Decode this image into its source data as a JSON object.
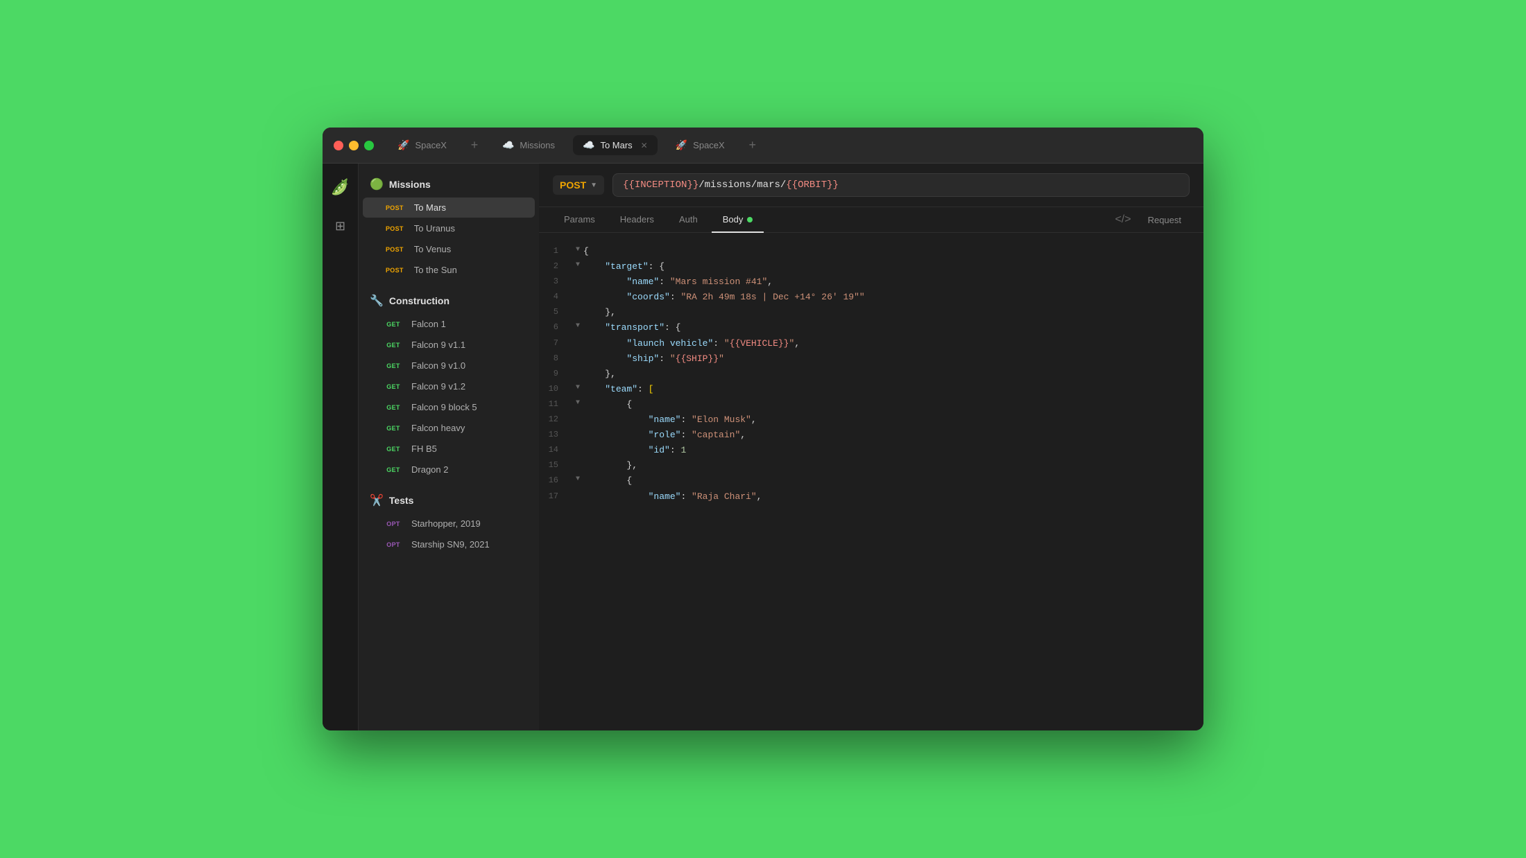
{
  "window": {
    "title": "SpaceX"
  },
  "tabs": [
    {
      "id": "tab-spacex-1",
      "label": "SpaceX",
      "icon": "🚀",
      "active": false,
      "closable": false
    },
    {
      "id": "tab-missions",
      "label": "Missions",
      "icon": "☁️",
      "active": false,
      "closable": false
    },
    {
      "id": "tab-tomars",
      "label": "To Mars",
      "icon": "☁️",
      "active": true,
      "closable": true
    },
    {
      "id": "tab-spacex-2",
      "label": "SpaceX",
      "icon": "🚀",
      "active": false,
      "closable": false
    }
  ],
  "sidebar": {
    "sections": [
      {
        "id": "missions",
        "label": "Missions",
        "icon": "🟢",
        "items": [
          {
            "id": "to-mars",
            "method": "POST",
            "name": "To Mars",
            "active": true
          },
          {
            "id": "to-uranus",
            "method": "POST",
            "name": "To Uranus",
            "active": false
          },
          {
            "id": "to-venus",
            "method": "POST",
            "name": "To Venus",
            "active": false
          },
          {
            "id": "to-the-sun",
            "method": "POST",
            "name": "To the Sun",
            "active": false
          }
        ]
      },
      {
        "id": "construction",
        "label": "Construction",
        "icon": "🔧",
        "items": [
          {
            "id": "falcon-1",
            "method": "GET",
            "name": "Falcon 1",
            "active": false
          },
          {
            "id": "falcon-9-v1-1",
            "method": "GET",
            "name": "Falcon 9 v1.1",
            "active": false
          },
          {
            "id": "falcon-9-v1-0",
            "method": "GET",
            "name": "Falcon 9 v1.0",
            "active": false
          },
          {
            "id": "falcon-9-v1-2",
            "method": "GET",
            "name": "Falcon 9 v1.2",
            "active": false
          },
          {
            "id": "falcon-9-block-5",
            "method": "GET",
            "name": "Falcon 9 block 5",
            "active": false
          },
          {
            "id": "falcon-heavy",
            "method": "GET",
            "name": "Falcon heavy",
            "active": false
          },
          {
            "id": "fh-b5",
            "method": "GET",
            "name": "FH B5",
            "active": false
          },
          {
            "id": "dragon-2",
            "method": "GET",
            "name": "Dragon 2",
            "active": false
          }
        ]
      },
      {
        "id": "tests",
        "label": "Tests",
        "icon": "✂️",
        "items": [
          {
            "id": "starhopper",
            "method": "OPT",
            "name": "Starhopper, 2019",
            "active": false
          },
          {
            "id": "starship-sn9",
            "method": "OPT",
            "name": "Starship SN9, 2021",
            "active": false
          }
        ]
      }
    ]
  },
  "url_bar": {
    "method": "POST",
    "url": "{{INCEPTION}}/missions/mars/{{ORBIT}}"
  },
  "req_tabs": {
    "params_label": "Params",
    "headers_label": "Headers",
    "auth_label": "Auth",
    "body_label": "Body",
    "request_label": "Request"
  },
  "code": [
    {
      "line": 1,
      "collapse": true,
      "indent": 0,
      "content": "{"
    },
    {
      "line": 2,
      "collapse": true,
      "indent": 1,
      "key": "target",
      "type": "obj_open"
    },
    {
      "line": 3,
      "collapse": false,
      "indent": 2,
      "key": "name",
      "value": "Mars mission #41",
      "type": "string"
    },
    {
      "line": 4,
      "collapse": false,
      "indent": 2,
      "key": "coords",
      "value": "RA 2h 49m 18s | Dec +14° 26' 19\"",
      "type": "string"
    },
    {
      "line": 5,
      "collapse": false,
      "indent": 1,
      "content": "},",
      "type": "close"
    },
    {
      "line": 6,
      "collapse": true,
      "indent": 1,
      "key": "transport",
      "type": "obj_open"
    },
    {
      "line": 7,
      "collapse": false,
      "indent": 2,
      "key": "launch vehicle",
      "value": "{{VEHICLE}}",
      "type": "var_string"
    },
    {
      "line": 8,
      "collapse": false,
      "indent": 2,
      "key": "ship",
      "value": "{{SHIP}}",
      "type": "var_string_last"
    },
    {
      "line": 9,
      "collapse": false,
      "indent": 1,
      "content": "},",
      "type": "close"
    },
    {
      "line": 10,
      "collapse": true,
      "indent": 1,
      "key": "team",
      "type": "arr_open"
    },
    {
      "line": 11,
      "collapse": true,
      "indent": 2,
      "type": "obj_open_bare"
    },
    {
      "line": 12,
      "collapse": false,
      "indent": 3,
      "key": "name",
      "value": "Elon Musk",
      "type": "string"
    },
    {
      "line": 13,
      "collapse": false,
      "indent": 3,
      "key": "role",
      "value": "captain",
      "type": "string"
    },
    {
      "line": 14,
      "collapse": false,
      "indent": 3,
      "key": "id",
      "value": 1,
      "type": "number"
    },
    {
      "line": 15,
      "collapse": false,
      "indent": 2,
      "content": "},",
      "type": "close"
    },
    {
      "line": 16,
      "collapse": true,
      "indent": 2,
      "type": "obj_open_bare"
    },
    {
      "line": 17,
      "collapse": false,
      "indent": 3,
      "key": "name",
      "value": "Raja Chari",
      "type": "string_partial"
    }
  ]
}
